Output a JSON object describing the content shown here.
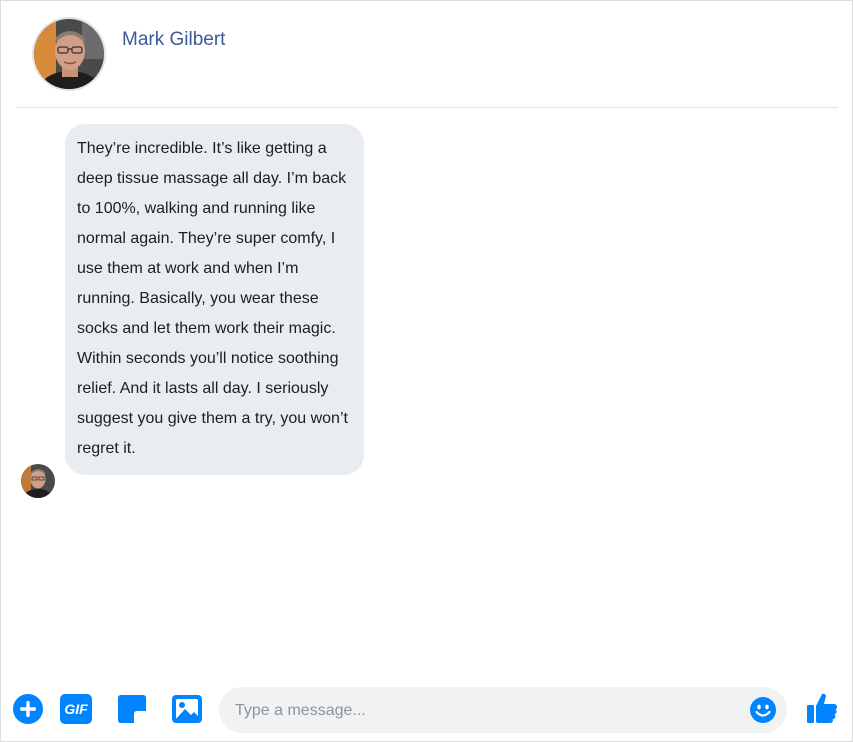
{
  "contact": {
    "name": "Mark Gilbert"
  },
  "message": {
    "text": "They’re incredible. It’s like getting a deep tissue massage all day. I’m back to 100%, walking and running like normal again. They’re super comfy, I use them at work and when I’m running. Basically, you wear these socks and let them work their magic. Within seconds you’ll notice soothing relief. And it lasts all day. I seriously suggest you give them a try, you won’t regret it."
  },
  "composer": {
    "placeholder": "Type a message...",
    "value": "",
    "gif_label": "GIF"
  },
  "icons": {
    "add": "plus-circle-icon",
    "gif": "gif-icon",
    "sticker": "sticker-icon",
    "image": "image-icon",
    "emoji": "smiley-icon",
    "like": "thumbs-up-icon"
  },
  "colors": {
    "accent": "#0084ff",
    "name": "#3b5998",
    "bubble": "#e9edf1",
    "input_bg": "#f1f2f4"
  }
}
